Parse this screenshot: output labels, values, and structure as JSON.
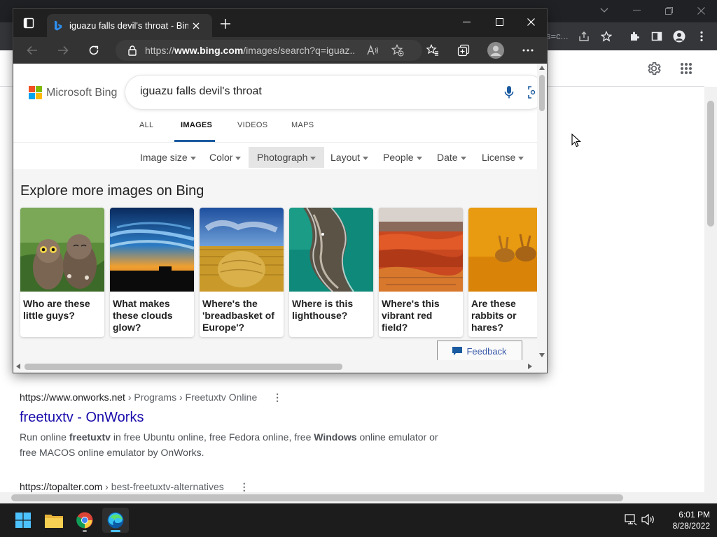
{
  "chrome": {
    "omnibox_tail": "s=c...",
    "results": [
      {
        "url_host": "https://www.onworks.net",
        "url_path": " › Programs › Freetuxtv Online",
        "title": "freetuxtv - OnWorks",
        "snippet_html_parts": [
          "Run online ",
          "freetuxtv",
          " in free Ubuntu online, free Fedora online, free ",
          "Windows",
          " online emulator or free MACOS online emulator by OnWorks."
        ]
      },
      {
        "url_host": "https://topalter.com",
        "url_path": " › best-freetuxtv-alternatives"
      }
    ]
  },
  "edge": {
    "tab_title": "iguazu falls devil's throat - Bing Images",
    "url_prefix": "https://",
    "url_domain": "www.bing.com",
    "url_rest": "/images/search?q=iguaz...",
    "bing": {
      "logo_text": "Microsoft Bing",
      "query": "iguazu falls devil's throat",
      "tabs": [
        "ALL",
        "IMAGES",
        "VIDEOS",
        "MAPS"
      ],
      "active_tab": "IMAGES",
      "filters": [
        "Image size",
        "Color",
        "Photograph",
        "Layout",
        "People",
        "Date",
        "License"
      ],
      "active_filter": "Photograph",
      "explore_title": "Explore more images on Bing",
      "cards": [
        {
          "caption": "Who are these little guys?",
          "image": "owls"
        },
        {
          "caption": "What makes these clouds glow?",
          "image": "glowing-clouds"
        },
        {
          "caption": "Where's the 'breadbasket of Europe'?",
          "image": "hay-bale-field"
        },
        {
          "caption": "Where is this lighthouse?",
          "image": "rocky-coast-aerial"
        },
        {
          "caption": "Where's this vibrant red field?",
          "image": "red-field"
        },
        {
          "caption": "Are these rabbits or hares?",
          "image": "hares"
        }
      ],
      "feedback_label": "Feedback"
    }
  },
  "taskbar": {
    "apps": [
      "start-icon",
      "file-explorer-icon",
      "chrome-icon",
      "edge-icon"
    ],
    "time": "6:01 PM",
    "date": "8/28/2022"
  },
  "colors": {
    "link": "#1a0dab",
    "bing_accent": "#1a5aa0",
    "taskbar": "#1c1c1c"
  }
}
